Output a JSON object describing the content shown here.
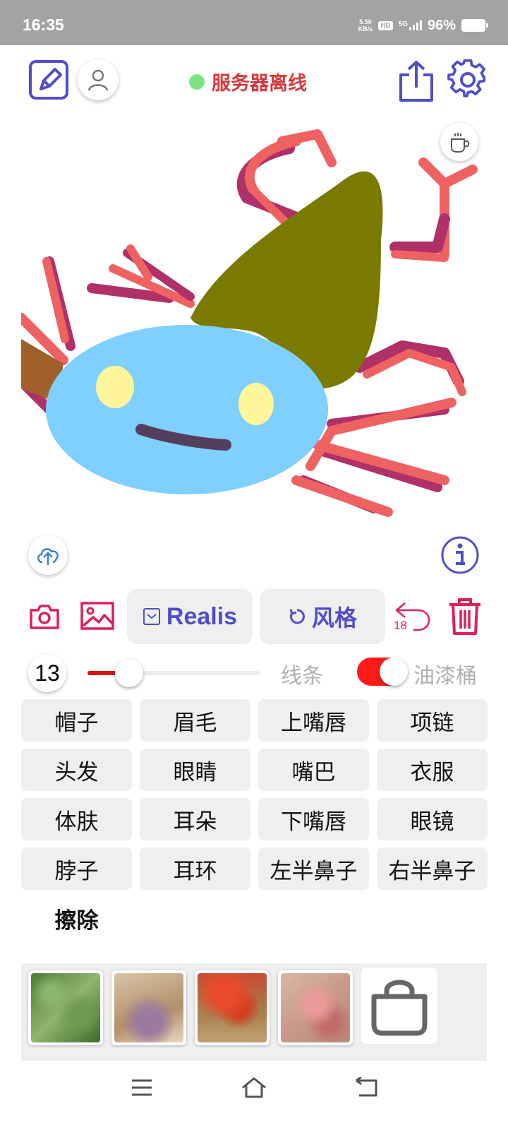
{
  "status_bar": {
    "time": "16:35",
    "net_speed_value": "5.50",
    "net_speed_unit": "KB/s",
    "hd_badge": "HD",
    "signal": "5G",
    "battery": "96%"
  },
  "header": {
    "server_status": "服务器离线",
    "server_status_color": "#7de37f"
  },
  "toolbar": {
    "style_model_label": "Realis",
    "style_label": "风格",
    "undo_count": "18"
  },
  "brush": {
    "size": "13",
    "size_fraction": 0.24,
    "line_label": "线条",
    "bucket_label": "油漆桶",
    "bucket_enabled": true
  },
  "parts": [
    "帽子",
    "眉毛",
    "上嘴唇",
    "项链",
    "头发",
    "眼睛",
    "嘴巴",
    "衣服",
    "体肤",
    "耳朵",
    "下嘴唇",
    "眼镜",
    "脖子",
    "耳环",
    "左半鼻子",
    "右半鼻子",
    "擦除"
  ],
  "colors": {
    "accent": "#4f4fc8",
    "danger": "#e01e5a",
    "server_text": "#d6393b",
    "toggle_on": "#ff1a1a"
  },
  "icons": {
    "edit": "edit-icon",
    "user": "user-icon",
    "share": "share-icon",
    "settings": "gear-icon",
    "coffee": "coffee-icon",
    "upload": "cloud-upload-icon",
    "info": "info-icon",
    "camera": "camera-icon",
    "image": "image-icon",
    "undo": "undo-icon",
    "trash": "trash-icon",
    "lock": "lock-icon"
  }
}
